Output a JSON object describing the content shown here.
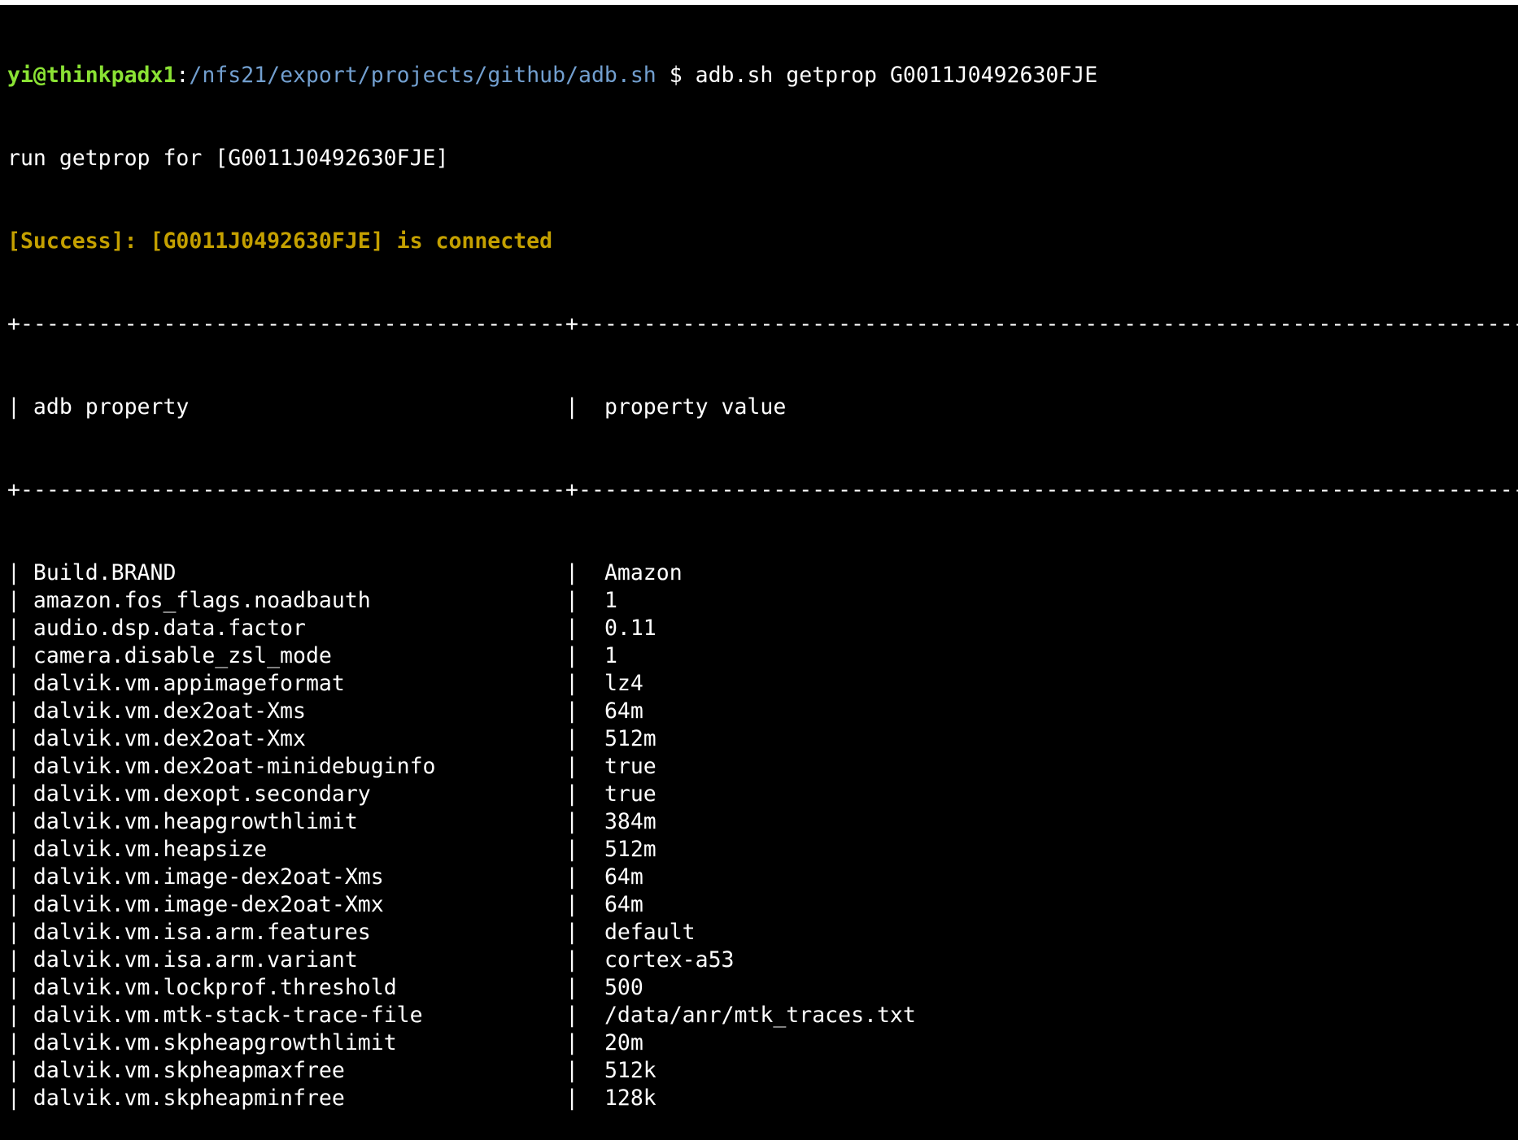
{
  "colors": {
    "background": "#000000",
    "text": "#ffffff",
    "prompt_user": "#8ae234",
    "prompt_path": "#729fcf",
    "success": "#c4a000"
  },
  "prompt": {
    "user_host": "yi@thinkpadx1",
    "separator": ":",
    "path": "/nfs21/export/projects/github/adb.sh",
    "symbol": " $ ",
    "command": "adb.sh getprop G0011J0492630FJE"
  },
  "output": {
    "run_line": "run getprop for [G0011J0492630FJE]",
    "success_line": "[Success]: [G0011J0492630FJE] is connected"
  },
  "table": {
    "border": "+------------------------------------------+---------------------------------------------------------------------------+",
    "headers": [
      "adb property",
      "property value"
    ],
    "rows": [
      [
        "Build.BRAND",
        "Amazon"
      ],
      [
        "amazon.fos_flags.noadbauth",
        "1"
      ],
      [
        "audio.dsp.data.factor",
        "0.11"
      ],
      [
        "camera.disable_zsl_mode",
        "1"
      ],
      [
        "dalvik.vm.appimageformat",
        "lz4"
      ],
      [
        "dalvik.vm.dex2oat-Xms",
        "64m"
      ],
      [
        "dalvik.vm.dex2oat-Xmx",
        "512m"
      ],
      [
        "dalvik.vm.dex2oat-minidebuginfo",
        "true"
      ],
      [
        "dalvik.vm.dexopt.secondary",
        "true"
      ],
      [
        "dalvik.vm.heapgrowthlimit",
        "384m"
      ],
      [
        "dalvik.vm.heapsize",
        "512m"
      ],
      [
        "dalvik.vm.image-dex2oat-Xms",
        "64m"
      ],
      [
        "dalvik.vm.image-dex2oat-Xmx",
        "64m"
      ],
      [
        "dalvik.vm.isa.arm.features",
        "default"
      ],
      [
        "dalvik.vm.isa.arm.variant",
        "cortex-a53"
      ],
      [
        "dalvik.vm.lockprof.threshold",
        "500"
      ],
      [
        "dalvik.vm.mtk-stack-trace-file",
        "/data/anr/mtk_traces.txt"
      ],
      [
        "dalvik.vm.skpheapgrowthlimit",
        "20m"
      ],
      [
        "dalvik.vm.skpheapmaxfree",
        "512k"
      ],
      [
        "dalvik.vm.skpheapminfree",
        "128k"
      ]
    ]
  }
}
